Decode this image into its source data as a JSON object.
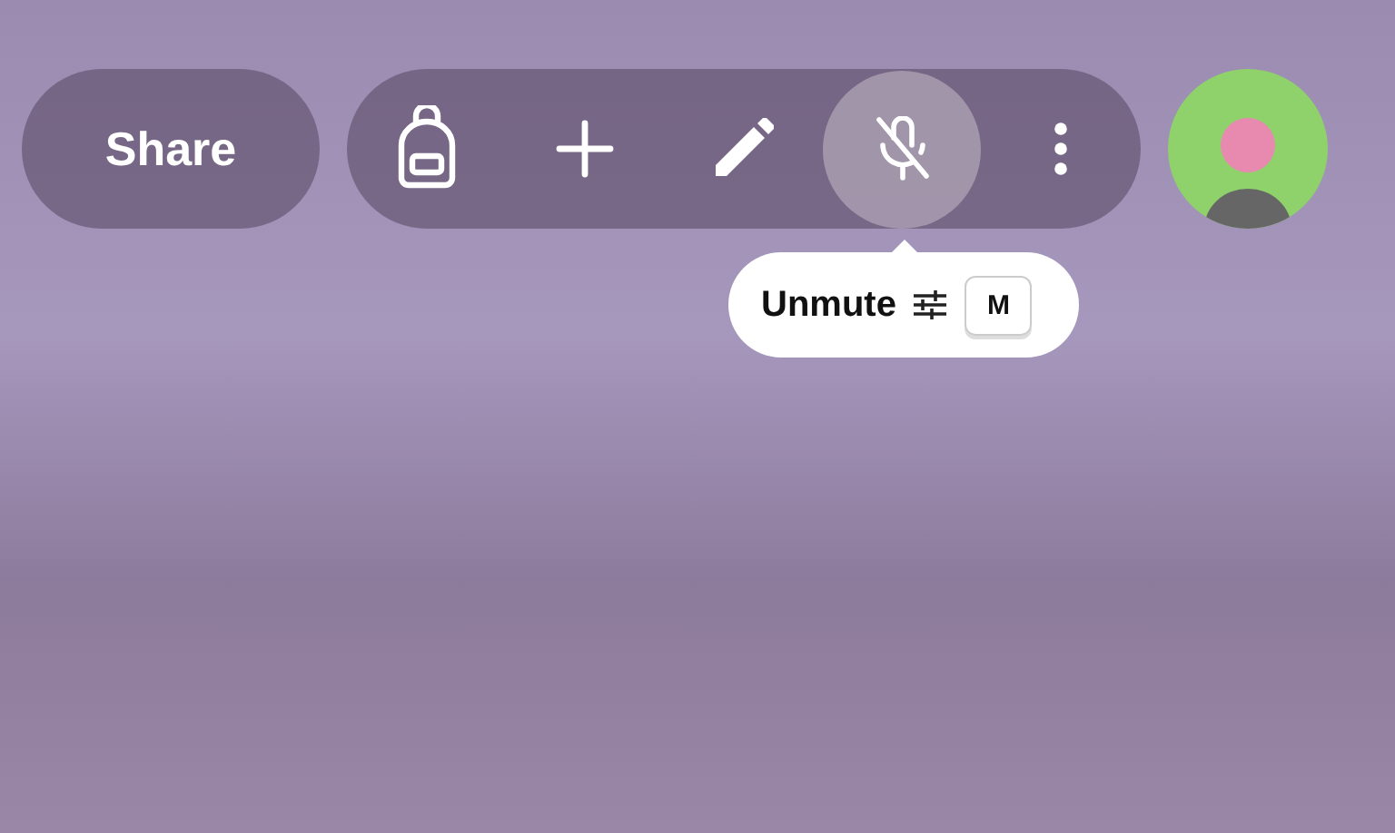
{
  "share_button": {
    "label": "Share"
  },
  "toolbar": [
    {
      "kind": "backpack",
      "highlighted": false
    },
    {
      "kind": "plus",
      "highlighted": false
    },
    {
      "kind": "pencil",
      "highlighted": false
    },
    {
      "kind": "mic-muted",
      "highlighted": true
    },
    {
      "kind": "more",
      "highlighted": false
    }
  ],
  "tooltip": {
    "label": "Unmute",
    "shortcut": "M"
  }
}
